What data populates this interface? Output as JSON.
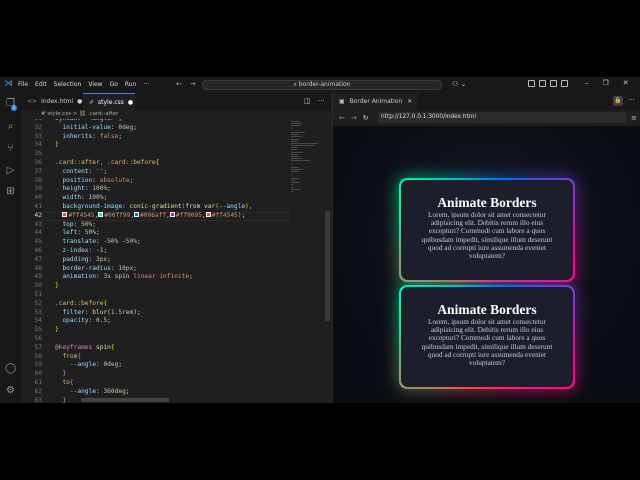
{
  "titlebar": {
    "menus": [
      "File",
      "Edit",
      "Selection",
      "View",
      "Go",
      "Run",
      "···"
    ],
    "search": "⌕ border-animation",
    "copilot": "⚇ ⌄",
    "window_controls": [
      "–",
      "❐",
      "✕"
    ]
  },
  "activity": {
    "badge": "2",
    "icons": [
      "explorer-icon",
      "search-icon",
      "source-control-icon",
      "run-debug-icon",
      "extensions-icon",
      "account-icon",
      "settings-icon"
    ]
  },
  "editor": {
    "tabs": [
      {
        "label": "index.html",
        "icon": "<>",
        "dirty": "●"
      },
      {
        "label": "style.css",
        "icon": "#",
        "dirty": "●"
      }
    ],
    "breadcrumb": [
      "# style.css",
      ">",
      "⛓ .card::after"
    ],
    "current_line": 42,
    "lines": [
      {
        "n": 31,
        "t": [
          [
            "syntax: '<angle>';",
            "t-plain"
          ]
        ]
      },
      {
        "n": 32,
        "t": [
          [
            "  initial-value",
            "t-prop"
          ],
          [
            ": ",
            "t-p"
          ],
          [
            "0deg",
            "t-num"
          ],
          [
            ";",
            "t-p"
          ]
        ]
      },
      {
        "n": 33,
        "t": [
          [
            "  inherits",
            "t-prop"
          ],
          [
            ": ",
            "t-p"
          ],
          [
            "false",
            "t-val"
          ],
          [
            ";",
            "t-p"
          ]
        ]
      },
      {
        "n": 34,
        "t": [
          [
            "}",
            "t-br"
          ]
        ]
      },
      {
        "n": 35,
        "t": []
      },
      {
        "n": 36,
        "t": [
          [
            ".card::after, .card::before",
            "t-sel"
          ],
          [
            "{",
            "t-br"
          ]
        ]
      },
      {
        "n": 37,
        "t": [
          [
            "  content",
            "t-prop"
          ],
          [
            ": ",
            "t-p"
          ],
          [
            "''",
            "t-val"
          ],
          [
            ";",
            "t-p"
          ]
        ]
      },
      {
        "n": 38,
        "t": [
          [
            "  position",
            "t-prop"
          ],
          [
            ": ",
            "t-p"
          ],
          [
            "absolute",
            "t-val"
          ],
          [
            ";",
            "t-p"
          ]
        ]
      },
      {
        "n": 39,
        "t": [
          [
            "  height",
            "t-prop"
          ],
          [
            ": ",
            "t-p"
          ],
          [
            "100%",
            "t-num"
          ],
          [
            ";",
            "t-p"
          ]
        ]
      },
      {
        "n": 40,
        "t": [
          [
            "  width",
            "t-prop"
          ],
          [
            ": ",
            "t-p"
          ],
          [
            "100%",
            "t-num"
          ],
          [
            ";",
            "t-p"
          ]
        ]
      },
      {
        "n": 41,
        "t": [
          [
            "  background-image",
            "t-prop"
          ],
          [
            ": ",
            "t-p"
          ],
          [
            "conic-gradient",
            "t-fn"
          ],
          [
            "(",
            "t-kw"
          ],
          [
            "from ",
            "t-p"
          ],
          [
            "var",
            "t-fn"
          ],
          [
            "(",
            "t-br"
          ],
          [
            "--angle",
            "t-prop"
          ],
          [
            ")",
            "t-br"
          ],
          [
            ",",
            "t-p"
          ]
        ]
      },
      {
        "n": 42,
        "t": [
          [
            "  ",
            "t-p"
          ],
          [
            "#ff4545",
            "sw"
          ],
          [
            "#ff4545",
            "t-val"
          ],
          [
            ",",
            "t-p"
          ],
          [
            "#00ff99",
            "sw"
          ],
          [
            "#00ff99",
            "t-val"
          ],
          [
            ",",
            "t-p"
          ],
          [
            "#006aff",
            "sw"
          ],
          [
            "#006aff",
            "t-val"
          ],
          [
            ",",
            "t-p"
          ],
          [
            "#ff0095",
            "sw"
          ],
          [
            "#ff0095",
            "t-val"
          ],
          [
            ",",
            "t-p"
          ],
          [
            "#ff4545",
            "sw"
          ],
          [
            "#ff4545",
            "t-val"
          ],
          [
            ")",
            "t-kw"
          ],
          [
            ";",
            "t-p"
          ]
        ]
      },
      {
        "n": 43,
        "t": [
          [
            "  top",
            "t-prop"
          ],
          [
            ": ",
            "t-p"
          ],
          [
            "50%",
            "t-num"
          ],
          [
            ";",
            "t-p"
          ]
        ]
      },
      {
        "n": 44,
        "t": [
          [
            "  left",
            "t-prop"
          ],
          [
            ": ",
            "t-p"
          ],
          [
            "50%",
            "t-num"
          ],
          [
            ";",
            "t-p"
          ]
        ]
      },
      {
        "n": 45,
        "t": [
          [
            "  translate",
            "t-prop"
          ],
          [
            ": ",
            "t-p"
          ],
          [
            "-50% -50%",
            "t-num"
          ],
          [
            ";",
            "t-p"
          ]
        ]
      },
      {
        "n": 46,
        "t": [
          [
            "  z-index",
            "t-prop"
          ],
          [
            ": ",
            "t-p"
          ],
          [
            "-1",
            "t-num"
          ],
          [
            ";",
            "t-p"
          ]
        ]
      },
      {
        "n": 47,
        "t": [
          [
            "  padding",
            "t-prop"
          ],
          [
            ": ",
            "t-p"
          ],
          [
            "3px",
            "t-num"
          ],
          [
            ";",
            "t-p"
          ]
        ]
      },
      {
        "n": 48,
        "t": [
          [
            "  border-radius",
            "t-prop"
          ],
          [
            ": ",
            "t-p"
          ],
          [
            "10px",
            "t-num"
          ],
          [
            ";",
            "t-p"
          ]
        ]
      },
      {
        "n": 49,
        "t": [
          [
            "  animation",
            "t-prop"
          ],
          [
            ": ",
            "t-p"
          ],
          [
            "3s",
            "t-num"
          ],
          [
            " spin ",
            "t-p"
          ],
          [
            "linear infinite",
            "t-val"
          ],
          [
            ";",
            "t-p"
          ]
        ]
      },
      {
        "n": 50,
        "t": [
          [
            "}",
            "t-br"
          ]
        ]
      },
      {
        "n": 51,
        "t": []
      },
      {
        "n": 52,
        "t": [
          [
            ".card::before",
            "t-sel"
          ],
          [
            "{",
            "t-br"
          ]
        ]
      },
      {
        "n": 53,
        "t": [
          [
            "  filter",
            "t-prop"
          ],
          [
            ": ",
            "t-p"
          ],
          [
            "blur",
            "t-fn"
          ],
          [
            "(",
            "t-p"
          ],
          [
            "1.5rem",
            "t-num"
          ],
          [
            ");",
            "t-p"
          ]
        ]
      },
      {
        "n": 54,
        "t": [
          [
            "  opacity",
            "t-prop"
          ],
          [
            ": ",
            "t-p"
          ],
          [
            "0.5",
            "t-num"
          ],
          [
            ";",
            "t-p"
          ]
        ]
      },
      {
        "n": 55,
        "t": [
          [
            "}",
            "t-br"
          ]
        ]
      },
      {
        "n": 56,
        "t": []
      },
      {
        "n": 57,
        "t": [
          [
            "@keyframes",
            "t-kw"
          ],
          [
            " spin",
            "t-fn"
          ],
          [
            "{",
            "t-br"
          ]
        ]
      },
      {
        "n": 58,
        "t": [
          [
            "  from",
            "t-sel"
          ],
          [
            "{",
            "t-kw"
          ]
        ]
      },
      {
        "n": 59,
        "t": [
          [
            "    --angle",
            "t-prop"
          ],
          [
            ": ",
            "t-p"
          ],
          [
            "0deg",
            "t-num"
          ],
          [
            ";",
            "t-p"
          ]
        ]
      },
      {
        "n": 60,
        "t": [
          [
            "  }",
            "t-kw"
          ]
        ]
      },
      {
        "n": 61,
        "t": [
          [
            "  to",
            "t-sel"
          ],
          [
            "{",
            "t-kw"
          ]
        ]
      },
      {
        "n": 62,
        "t": [
          [
            "    --angle",
            "t-prop"
          ],
          [
            ": ",
            "t-p"
          ],
          [
            "360deg",
            "t-num"
          ],
          [
            ";",
            "t-p"
          ]
        ]
      },
      {
        "n": 63,
        "t": [
          [
            "  }",
            "t-kw"
          ]
        ]
      }
    ]
  },
  "browser": {
    "tab_label": "Border Animation",
    "tab_close": "✕",
    "lock": "🔒",
    "more": "···",
    "back": "←",
    "forward": "→",
    "reload": "↻",
    "url": "http://127.0.0.1:3000/index.html",
    "menu": "≡",
    "cards": [
      {
        "title": "Animate Borders",
        "text": "Lorem, ipsum dolor sit amet consectetur adipisicing elit. Debitis rerum illo eius excepturi? Commodi cum labore a quos quibusdam impedit, similique illum deserunt quod ad corrupti iure assumenda eveniet voluptatem?"
      },
      {
        "title": "Animate Borders",
        "text": "Lorem, ipsum dolor sit amet consectetur adipisicing elit. Debitis rerum illo eius excepturi? Commodi cum labore a quos quibusdam impedit, similique illum deserunt quod ad corrupti iure assumenda eveniet voluptatem?"
      }
    ],
    "gradient_colors": [
      "#ff4545",
      "#00ff99",
      "#006aff",
      "#ff0095",
      "#ff4545"
    ]
  },
  "colors": {
    "accent": "#3b82f6",
    "editor_bg": "#1f1f1f",
    "page_bg": "#0e1118"
  }
}
